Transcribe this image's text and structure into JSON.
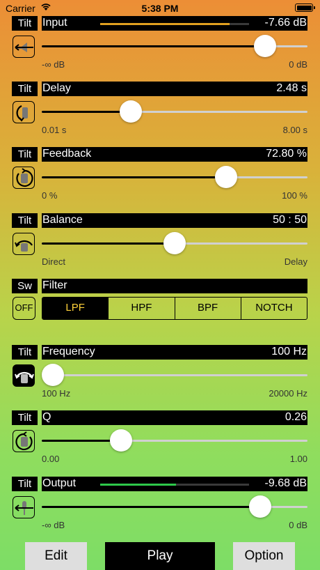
{
  "status": {
    "carrier": "Carrier",
    "time": "5:38 PM"
  },
  "controls": {
    "input": {
      "mode": "Tilt",
      "name": "Input",
      "value": "-7.66 dB",
      "min": "-∞ dB",
      "max": "0 dB",
      "level": 0.87,
      "meter": 0.87,
      "meter_color": "#e0a020"
    },
    "delay": {
      "mode": "Tilt",
      "name": "Delay",
      "value": "2.48 s",
      "min": "0.01 s",
      "max": "8.00 s",
      "level": 0.32
    },
    "feedback": {
      "mode": "Tilt",
      "name": "Feedback",
      "value": "72.80 %",
      "min": "0 %",
      "max": "100 %",
      "level": 0.71
    },
    "balance": {
      "mode": "Tilt",
      "name": "Balance",
      "value": "50 : 50",
      "min": "Direct",
      "max": "Delay",
      "level": 0.5
    },
    "frequency": {
      "mode": "Tilt",
      "name": "Frequency",
      "value": "100 Hz",
      "min": "100 Hz",
      "max": "20000 Hz",
      "level": 0.0
    },
    "q": {
      "mode": "Tilt",
      "name": "Q",
      "value": "0.26",
      "min": "0.00",
      "max": "1.00",
      "level": 0.28
    },
    "output": {
      "mode": "Tilt",
      "name": "Output",
      "value": "-9.68 dB",
      "min": "-∞ dB",
      "max": "0 dB",
      "level": 0.85,
      "meter": 0.51,
      "meter_color": "#2ec84a"
    }
  },
  "filter": {
    "mode": "Sw",
    "name": "Filter",
    "off": "OFF",
    "options": [
      "LPF",
      "HPF",
      "BPF",
      "NOTCH"
    ],
    "selected": "LPF"
  },
  "bottom": {
    "edit": "Edit",
    "play": "Play",
    "option": "Option"
  },
  "icons": {
    "input": "speaker-tilt-icon",
    "delay": "rotate-left-icon",
    "feedback": "rotate-circle-icon",
    "balance": "phone-tilt-icon",
    "frequency": "phone-flip-icon",
    "q": "rotate-circle-icon",
    "output": "microphone-tilt-icon"
  }
}
